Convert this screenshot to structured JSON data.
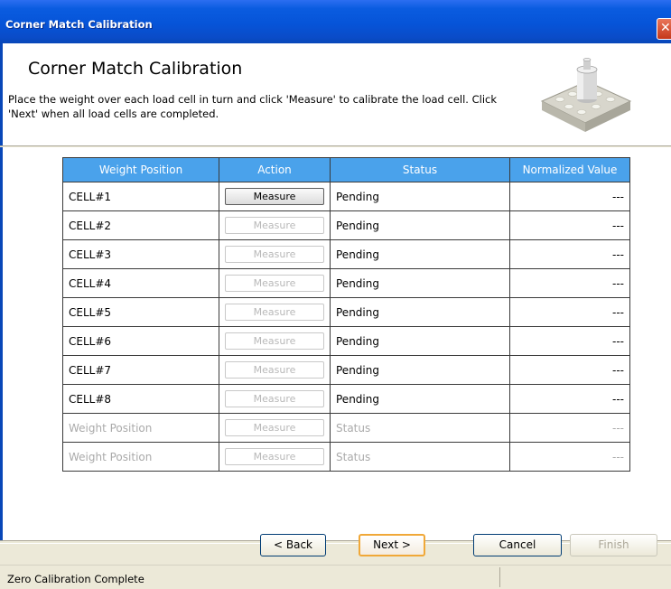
{
  "window": {
    "title": "Corner Match Calibration"
  },
  "header": {
    "title": "Corner Match Calibration",
    "description": "Place the weight over each load cell in turn and click 'Measure' to calibrate the load cell. Click 'Next' when all load cells are completed."
  },
  "table": {
    "columns": [
      "Weight Position",
      "Action",
      "Status",
      "Normalized Value"
    ],
    "rows": [
      {
        "position": "CELL#1",
        "action": "Measure",
        "status": "Pending",
        "value": "---"
      },
      {
        "position": "CELL#2",
        "action": "Measure",
        "status": "Pending",
        "value": "---"
      },
      {
        "position": "CELL#3",
        "action": "Measure",
        "status": "Pending",
        "value": "---"
      },
      {
        "position": "CELL#4",
        "action": "Measure",
        "status": "Pending",
        "value": "---"
      },
      {
        "position": "CELL#5",
        "action": "Measure",
        "status": "Pending",
        "value": "---"
      },
      {
        "position": "CELL#6",
        "action": "Measure",
        "status": "Pending",
        "value": "---"
      },
      {
        "position": "CELL#7",
        "action": "Measure",
        "status": "Pending",
        "value": "---"
      },
      {
        "position": "CELL#8",
        "action": "Measure",
        "status": "Pending",
        "value": "---"
      },
      {
        "position": "Weight Position",
        "action": "Measure",
        "status": "Status",
        "value": "---"
      },
      {
        "position": "Weight Position",
        "action": "Measure",
        "status": "Status",
        "value": "---"
      }
    ]
  },
  "buttons": {
    "back": "< Back",
    "next": "Next >",
    "cancel": "Cancel",
    "finish": "Finish"
  },
  "statusbar": {
    "text": "Zero Calibration Complete"
  },
  "colors": {
    "titlebar": "#0654d8",
    "header_grid": "#4aa2eb",
    "next_focus": "#f0a838"
  },
  "icons": {
    "close": "close-icon",
    "product": "load-cell-platform-icon"
  }
}
